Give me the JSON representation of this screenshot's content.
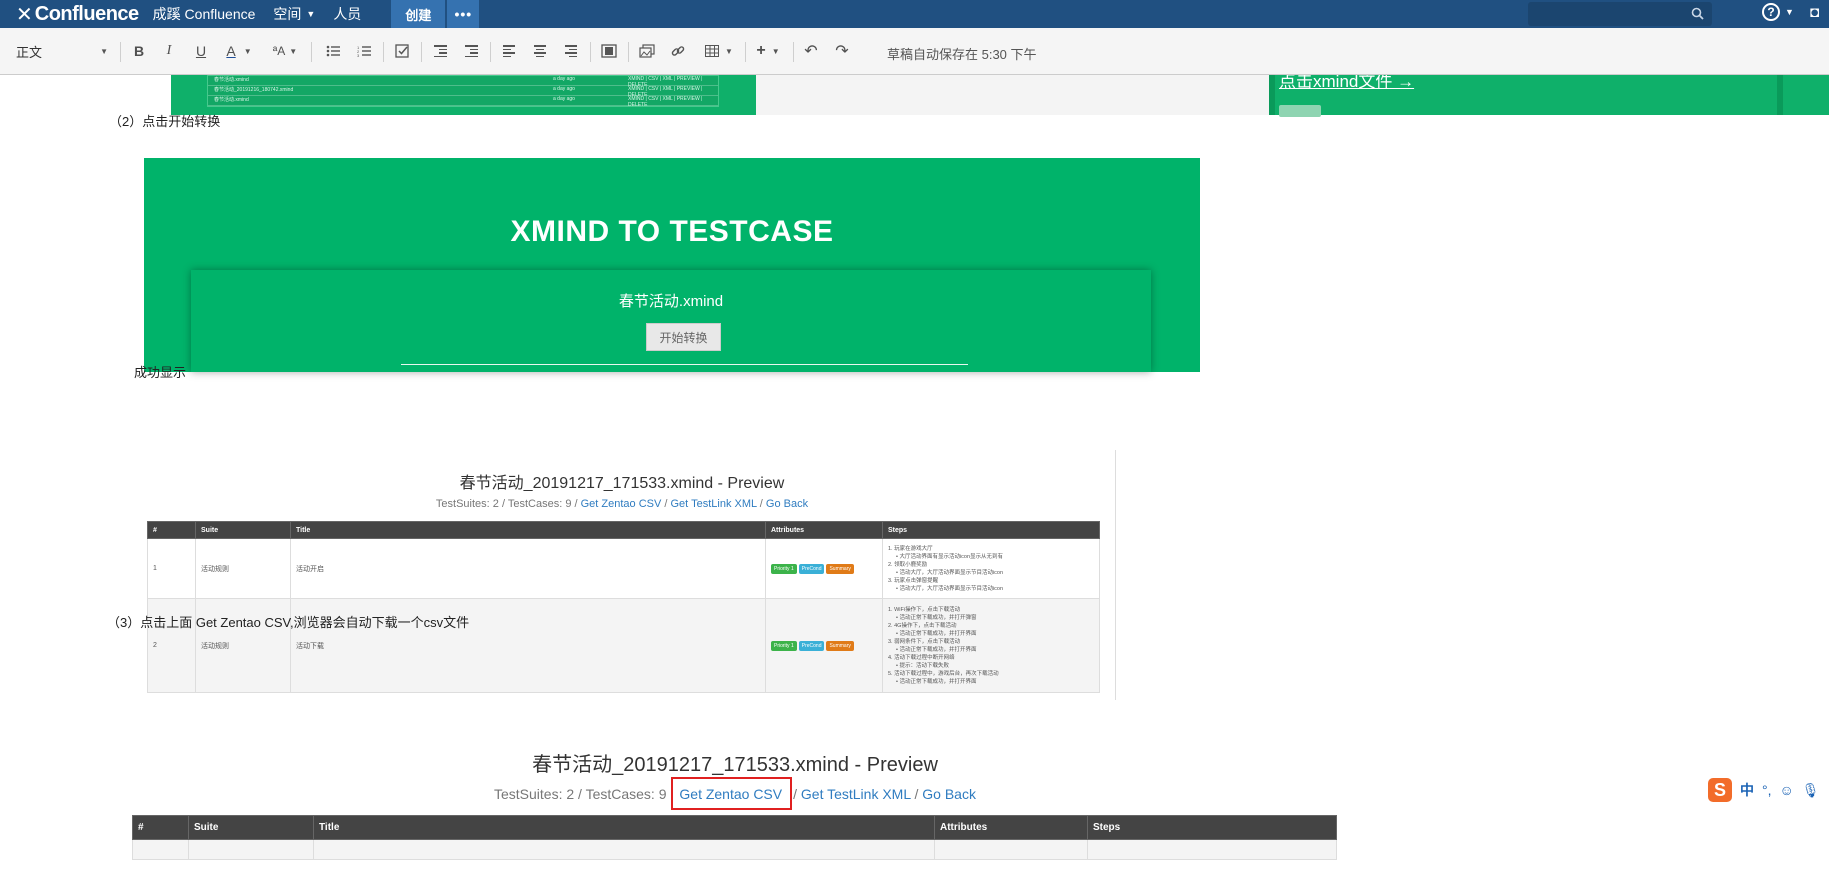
{
  "nav": {
    "logo": "Confluence",
    "site": "成蹊 Confluence",
    "spaces": "空间",
    "people": "人员",
    "create": "创建",
    "more": "•••"
  },
  "toolbar": {
    "paragraph_style": "正文",
    "autosave": "草稿自动保存在 5:30 下午"
  },
  "content": {
    "step2": "（2）点击开始转换",
    "banner_title": "XMIND TO TESTCASE",
    "banner_file": "春节活动.xmind",
    "banner_button": "开始转换",
    "success": "成功显示",
    "step3": "（3）点击上面    Get Zentao CSV,浏览器会自动下载一个csv文件",
    "top_strip_rows": [
      {
        "name": "春节活动.xmind",
        "time": "a day ago",
        "links": "XMIND | CSV | XML | PREVIEW | DELETE"
      },
      {
        "name": "春节活动_20191216_180742.xmind",
        "time": "a day ago",
        "links": "XMIND | CSV | XML | PREVIEW | DELETE"
      },
      {
        "name": "春节活动.xmind",
        "time": "a day ago",
        "links": "XMIND | CSV | XML | PREVIEW | DELETE"
      }
    ],
    "top_right_text": "点击xmind文件 →"
  },
  "preview": {
    "title": "春节活动_20191217_171533.xmind - Preview",
    "summary": "TestSuites: 2 / TestCases: 9 / ",
    "link_csv": "Get Zentao CSV",
    "link_xml": "Get TestLink XML",
    "link_back": "Go Back",
    "slash": " / ",
    "columns": [
      "#",
      "Suite",
      "Title",
      "Attributes",
      "Steps"
    ],
    "rows": [
      {
        "num": "1",
        "suite": "活动规则",
        "title": "活动开启",
        "badges": [
          "Priority 1",
          "PreCond",
          "Summary"
        ],
        "steps": [
          "1. 玩家在游戏大厅",
          "• 大厅活动界面有显示活动icon显示从无到有",
          "2. 领取小鹿奖励",
          "• 活动大厅，大厅活动界面显示节目活动icon",
          "3. 玩家点击弹窗提醒",
          "• 活动大厅，大厅活动界面显示节目活动icon"
        ]
      },
      {
        "num": "2",
        "suite": "活动规则",
        "title": "活动下载",
        "badges": [
          "Priority 1",
          "PreCond",
          "Summary"
        ],
        "steps": [
          "1. WiFi操作下，点击下载活动",
          "• 活动正常下载成功，并打开弹窗",
          "2. 4G操作下，点击下载活动",
          "• 活动正常下载成功，并打开界面",
          "3. 弱网条件下，点击下载活动",
          "• 活动正常下载成功，并打开界面",
          "4. 活动下载过程中断开网络",
          "• 提示：活动下载失败",
          "5. 活动下载过程中，游戏后台，再次下载活动",
          "• 活动正常下载成功，并打开界面"
        ]
      }
    ]
  },
  "preview_large": {
    "title": "春节活动_20191217_171533.xmind - Preview",
    "summary": "TestSuites: 2 / TestCases: 9",
    "link_csv": "Get Zentao CSV",
    "link_xml": "Get TestLink XML",
    "link_back": "Go Back",
    "columns": [
      "#",
      "Suite",
      "Title",
      "Attributes",
      "Steps"
    ]
  },
  "ime": {
    "zh": "中",
    "punct": "°,"
  },
  "colors": {
    "nav_bg": "#205081",
    "create_bg": "#3572b0",
    "green": "#00b36a",
    "link": "#2f7cc0",
    "highlight": "#e02020"
  }
}
